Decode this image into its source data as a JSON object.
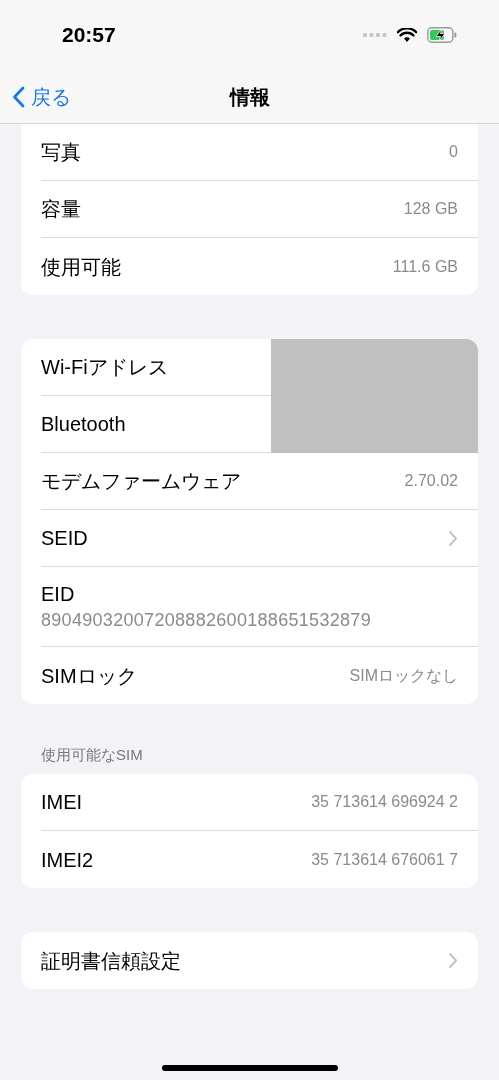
{
  "status_bar": {
    "time": "20:57"
  },
  "nav": {
    "back": "戻る",
    "title": "情報"
  },
  "groups": [
    {
      "rows": [
        {
          "kind": "value",
          "label": "写真",
          "value": "0"
        },
        {
          "kind": "value",
          "label": "容量",
          "value": "128 GB"
        },
        {
          "kind": "value",
          "label": "使用可能",
          "value": "111.6 GB"
        }
      ]
    },
    {
      "rows": [
        {
          "kind": "redacted",
          "label": "Wi-Fiアドレス"
        },
        {
          "kind": "redacted",
          "label": "Bluetooth"
        },
        {
          "kind": "value",
          "label": "モデムファームウェア",
          "value": "2.70.02"
        },
        {
          "kind": "chevron",
          "label": "SEID"
        },
        {
          "kind": "stacked",
          "label": "EID",
          "value": "89049032007208882600188651532879"
        },
        {
          "kind": "value",
          "label": "SIMロック",
          "value": "SIMロックなし"
        }
      ]
    },
    {
      "header": "使用可能なSIM",
      "rows": [
        {
          "kind": "value",
          "label": "IMEI",
          "value": "35 713614 696924 2"
        },
        {
          "kind": "value",
          "label": "IMEI2",
          "value": "35 713614 676061 7"
        }
      ]
    },
    {
      "rows": [
        {
          "kind": "chevron",
          "label": "証明書信頼設定"
        }
      ]
    }
  ]
}
